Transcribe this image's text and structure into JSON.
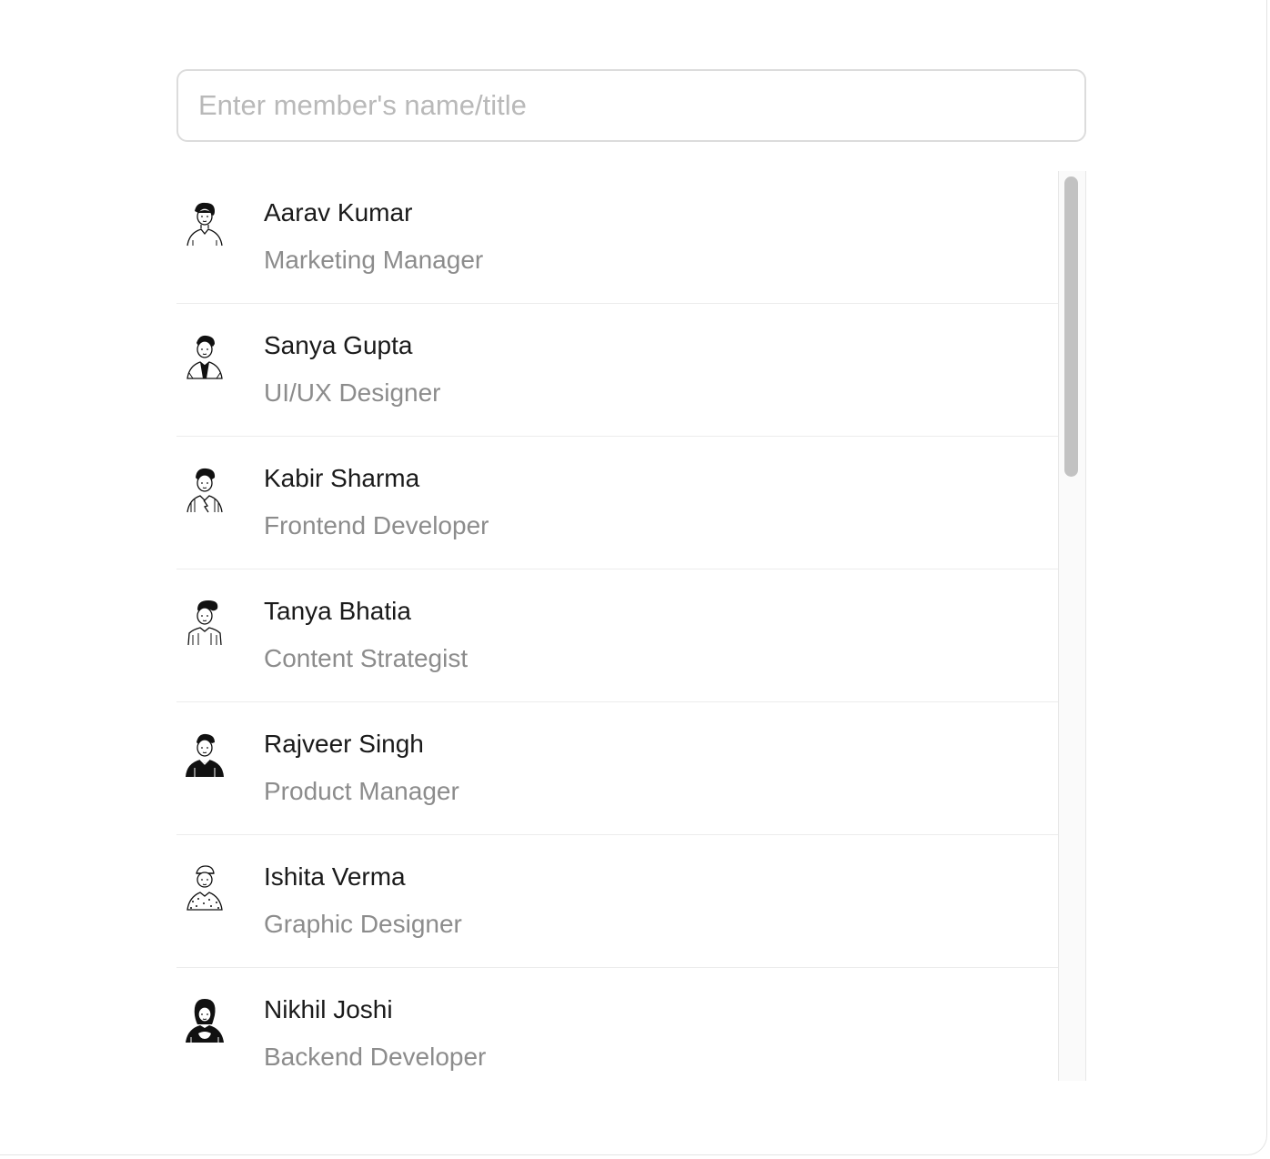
{
  "search": {
    "placeholder": "Enter member's name/title",
    "value": ""
  },
  "members": [
    {
      "name": "Aarav Kumar",
      "title": "Marketing Manager",
      "avatar": "avatar-man-curly-hair-icon"
    },
    {
      "name": "Sanya Gupta",
      "title": "UI/UX Designer",
      "avatar": "avatar-man-jacket-icon"
    },
    {
      "name": "Kabir Sharma",
      "title": "Frontend Developer",
      "avatar": "avatar-man-striped-shirt-icon"
    },
    {
      "name": "Tanya Bhatia",
      "title": "Content Strategist",
      "avatar": "avatar-man-pompadour-icon"
    },
    {
      "name": "Rajveer Singh",
      "title": "Product Manager",
      "avatar": "avatar-man-dark-sweater-icon"
    },
    {
      "name": "Ishita Verma",
      "title": "Graphic Designer",
      "avatar": "avatar-man-cap-dotted-shirt-icon"
    },
    {
      "name": "Nikhil Joshi",
      "title": "Backend Developer",
      "avatar": "avatar-woman-dark-top-icon"
    }
  ],
  "colors": {
    "name_text": "#1a1a1a",
    "title_text": "#8c8c8c",
    "border": "#dcdcdc",
    "scroll_thumb": "#c2c2c2"
  }
}
